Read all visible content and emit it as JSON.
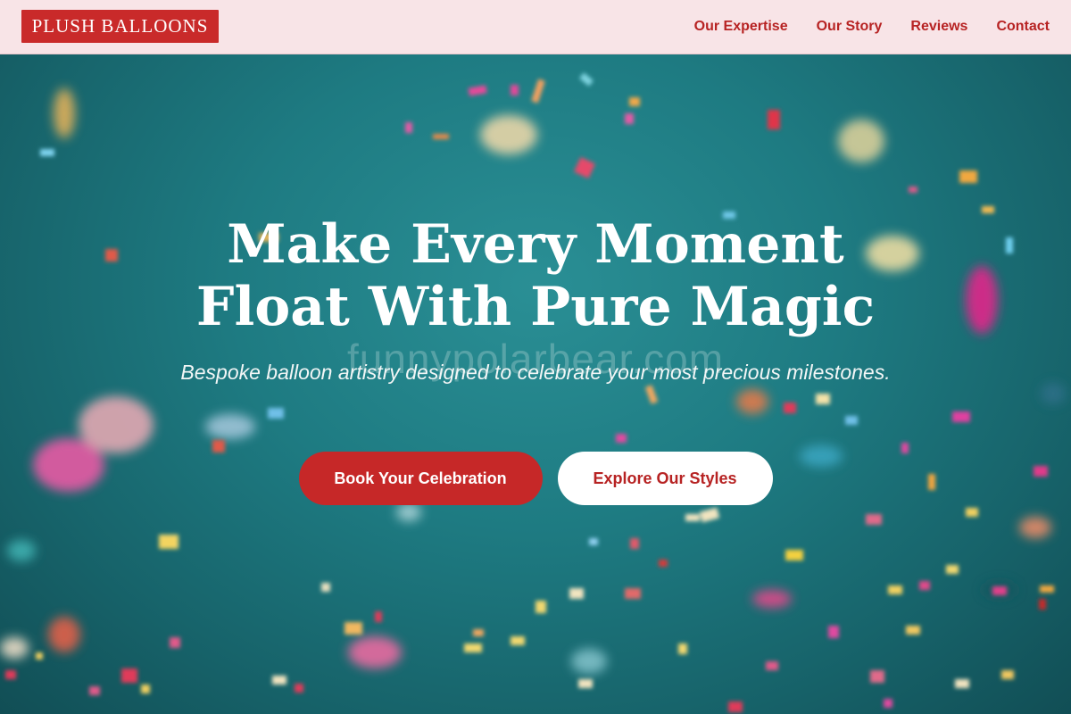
{
  "brand": {
    "logo_text": "PLUSH BALLOONS"
  },
  "nav": {
    "items": [
      {
        "label": "Our Expertise"
      },
      {
        "label": "Our Story"
      },
      {
        "label": "Reviews"
      },
      {
        "label": "Contact"
      }
    ]
  },
  "hero": {
    "title_line1": "Make Every Moment",
    "title_line2": "Float With Pure Magic",
    "subtitle": "Bespoke balloon artistry designed to celebrate your most precious milestones.",
    "watermark": "funnypolarbear.com",
    "primary_cta": "Book Your Celebration",
    "secondary_cta": "Explore Our Styles"
  },
  "colors": {
    "accent": "#c62828",
    "nav_bg": "#f8e4e7",
    "hero_bg": "#1e7b82"
  }
}
